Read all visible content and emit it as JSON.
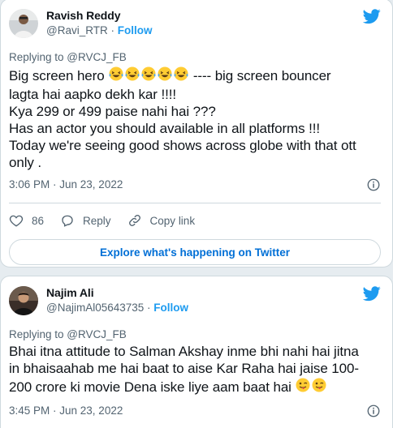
{
  "tweets": [
    {
      "author": "Ravish Reddy",
      "handle": "@Ravi_RTR",
      "follow": "Follow",
      "replying": "Replying to @RVCJ_FB",
      "line1": "Big screen hero ",
      "line1b": " ---- big screen bouncer",
      "body_rest": "lagta hai aapko dekh kar !!!!\nKya 299 or 499 paise nahi hai ???\nHas an actor you should available in all platforms !!!\nToday we're seeing good shows across globe with that ott\nonly .",
      "emoji_count": 5,
      "emoji": "laughing-crying",
      "time": "3:06 PM · Jun 23, 2022",
      "likes": "86",
      "reply_label": "Reply",
      "copy_label": "Copy link",
      "explore": "Explore what's happening on Twitter"
    },
    {
      "author": "Najim Ali",
      "handle": "@NajimAl05643735",
      "follow": "Follow",
      "replying": "Replying to @RVCJ_FB",
      "body": "Bhai itna attitude to Salman Akshay inme bhi nahi hai jitna\nin bhaisaahab me hai baat to aise Kar Raha hai jaise 100-\n200 crore ki movie Dena iske liye aam baat hai ",
      "emoji_count": 2,
      "emoji": "winking-tongue",
      "time": "3:45 PM · Jun 23, 2022"
    }
  ],
  "colors": {
    "accent": "#1d9bf0",
    "link": "#006fd6",
    "muted": "#536471",
    "border": "#cfd9de"
  }
}
